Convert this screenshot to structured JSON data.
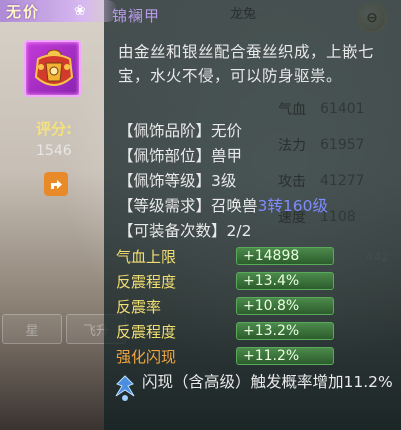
{
  "item": {
    "rarity": "无价",
    "name": "锦襕甲",
    "description": "由金丝和银丝配合蚕丝织成，上嵌七宝，水火不侵，可以防身驱祟。",
    "score_label": "评分:",
    "score_value": "1546"
  },
  "info": {
    "grade": "【佩饰品阶】无价",
    "slot": "【佩饰部位】兽甲",
    "level": "【佩饰等级】3级",
    "req_prefix": "【等级需求】召唤兽",
    "req_value": "3转160级",
    "equip_count": "【可装备次数】2/2"
  },
  "stats": [
    {
      "name": "气血上限",
      "value": "+14898"
    },
    {
      "name": "反震程度",
      "value": "+13.4%"
    },
    {
      "name": "反震率",
      "value": "+10.8%"
    },
    {
      "name": "反震程度",
      "value": "+13.2%"
    },
    {
      "name": "强化闪现",
      "value": "+11.2%"
    }
  ],
  "effect": {
    "text": "闪现（含高级）触发概率增加11.2%",
    "icon": "flash-effect-icon"
  },
  "background": {
    "top_label": "龙兔",
    "stats": [
      {
        "label": "气血",
        "value": "61401"
      },
      {
        "label": "法力",
        "value": "61957"
      },
      {
        "label": "攻击",
        "value": "41277"
      },
      {
        "label": "速度",
        "value": "1108"
      }
    ],
    "tabs": [
      "星",
      "飞升"
    ],
    "number": "442"
  },
  "colors": {
    "rarity_bg": "#b08bd6",
    "item_name": "#b79ae8",
    "stat_name": "#f2df72",
    "stat_bar": "#4c8a4c",
    "highlight": "#7d8cff"
  }
}
